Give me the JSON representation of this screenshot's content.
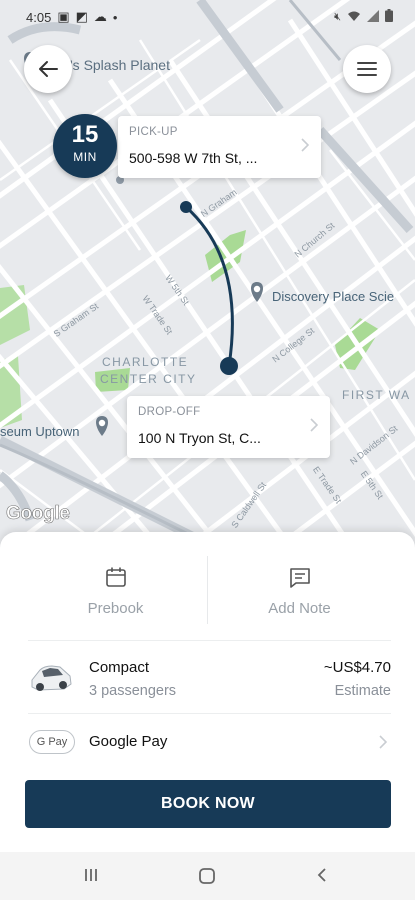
{
  "status_bar": {
    "time": "4:05"
  },
  "map": {
    "labels": {
      "poi_top": "'s Splash Planet",
      "discovery": "Discovery Place Scie",
      "center_city_1": "CHARLOTTE",
      "center_city_2": "CENTER CITY",
      "museum": "seum Uptown",
      "first_ward": "FIRST WA",
      "google": "Google"
    },
    "streets": {
      "n_graham": "N Graham",
      "n_church": "N Church St",
      "w_5th": "W 5th St",
      "w_trade": "W Trade St",
      "s_graham": "S Graham St",
      "n_college": "N College St",
      "n_davidson": "N Davidson St",
      "e_trade": "E Trade St",
      "s_caldwell": "S Caldwell St",
      "e_5th": "E 5th St"
    },
    "eta": {
      "number": "15",
      "unit": "MIN"
    },
    "pickup": {
      "label": "PICK-UP",
      "address": "500-598 W 7th St, ..."
    },
    "dropoff": {
      "label": "DROP-OFF",
      "address": "100 N Tryon St, C..."
    }
  },
  "sheet": {
    "prebook_label": "Prebook",
    "add_note_label": "Add Note",
    "vehicle": {
      "name": "Compact",
      "capacity": "3 passengers",
      "price": "~US$4.70",
      "price_note": "Estimate"
    },
    "payment": {
      "badge": "G Pay",
      "method": "Google Pay"
    },
    "book_button": "BOOK NOW"
  },
  "colors": {
    "primary": "#173a57",
    "park": "#9fd68a",
    "road": "#ffffff",
    "map_bg": "#e9ecef"
  }
}
